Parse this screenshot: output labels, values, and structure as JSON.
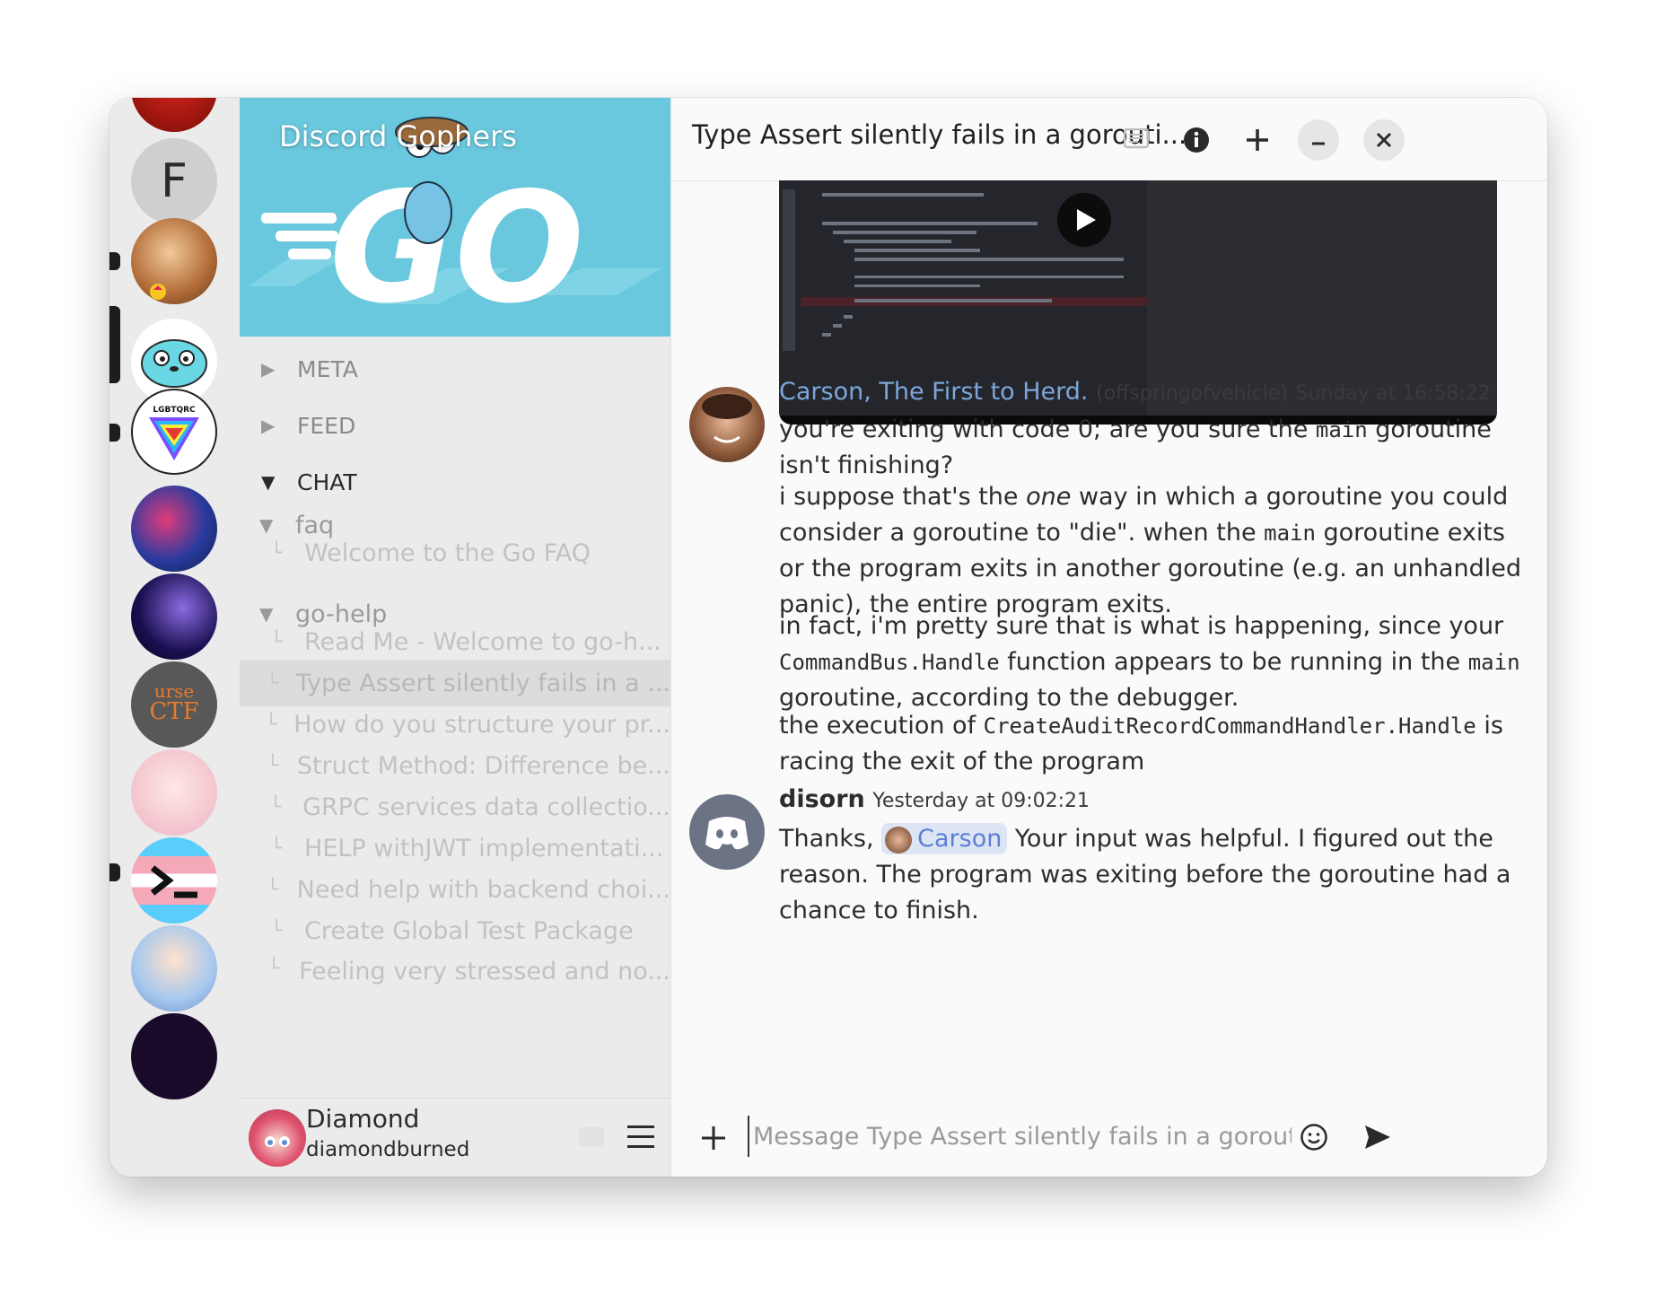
{
  "server_rail": {
    "letter_server": "F"
  },
  "channel_panel": {
    "server_name": "Discord Gophers",
    "categories": [
      {
        "label": "META",
        "expanded": false
      },
      {
        "label": "FEED",
        "expanded": false
      },
      {
        "label": "CHAT",
        "expanded": true
      }
    ],
    "forums": [
      {
        "label": "faq",
        "threads": [
          "Welcome to the Go FAQ"
        ]
      },
      {
        "label": "go-help",
        "threads": [
          "Read Me - Welcome to go-h...",
          "Type Assert silently fails in a ...",
          "How do you structure your pr...",
          "Struct Method: Difference be...",
          "GRPC services data collectio...",
          "HELP withJWT implementati...",
          "Need help with backend choi...",
          "Create Global Test Package",
          "Feeling very stressed and no..."
        ]
      }
    ],
    "user": {
      "display_name": "Diamond",
      "username": "diamondburned"
    }
  },
  "chat": {
    "title": "Type Assert silently fails in a gorouti...",
    "messages": [
      {
        "author": "Carson, The First to Herd.",
        "username": "(offspringofvehicle)",
        "timestamp": "Sunday at 16:58:22",
        "author_color": "#7ba7dc",
        "paragraphs": [
          {
            "p1": "you're exiting with code 0; are you sure the ",
            "c1": "main",
            "p2": " goroutine isn't finishing?"
          },
          {
            "p1": "i suppose that's the ",
            "em": "one",
            "p2": " way in which a goroutine you could consider a goroutine to \"die\". when the ",
            "c1": "main",
            "p3": " goroutine exits or the program exits in another goroutine (e.g. an unhandled panic), the entire program exits."
          },
          {
            "p1": "in fact, i'm pretty sure that is what is happening, since your ",
            "c1": "CommandBus.Handle",
            "p2": " function appears to be running in the ",
            "c2": "main",
            "p3": " goroutine, according to the debugger."
          },
          {
            "p1": "the execution of ",
            "c1": "CreateAuditRecordCommandHandler.Handle",
            "p2": " is racing the exit of the program"
          }
        ]
      },
      {
        "author": "disorn",
        "timestamp": "Yesterday at 09:02:21",
        "pre": "Thanks, ",
        "mention": "Carson",
        "post": " Your input was helpful. I figured out the reason. The program was exiting before the goroutine had a chance to finish."
      }
    ],
    "composer_placeholder": "Message Type Assert silently fails in a goroutine, is ..."
  },
  "colors": {
    "banner": "#69c8dd",
    "mention_text": "#5a7fd6",
    "mention_bg": "#dde5f5"
  }
}
